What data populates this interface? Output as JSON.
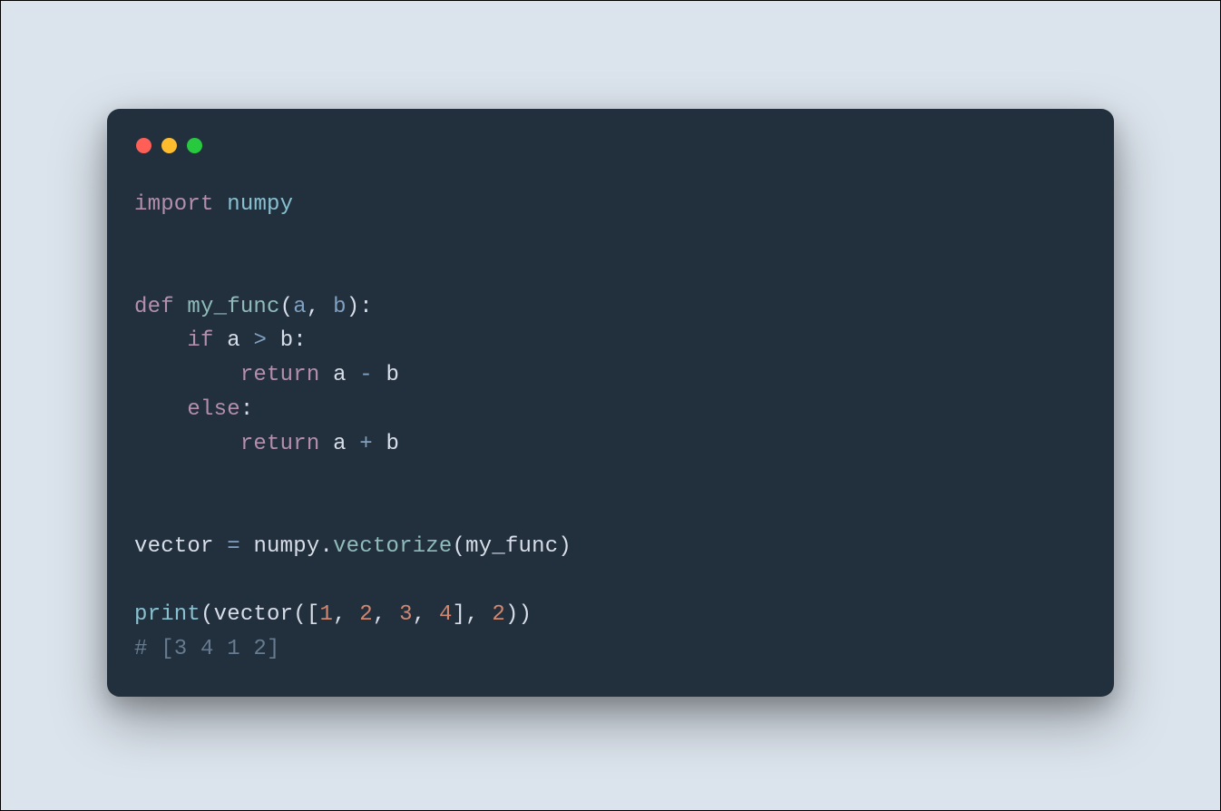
{
  "window": {
    "controls": {
      "close": "close",
      "minimize": "minimize",
      "maximize": "maximize"
    }
  },
  "code": {
    "line1": {
      "import_kw": "import",
      "module": "numpy"
    },
    "line2": "",
    "line3": "",
    "line4": {
      "def_kw": "def",
      "func_name": "my_func",
      "lparen": "(",
      "param_a": "a",
      "comma": ",",
      "space": " ",
      "param_b": "b",
      "rparen": ")",
      "colon": ":"
    },
    "line5": {
      "indent": "    ",
      "if_kw": "if",
      "a": "a",
      "gt": ">",
      "b": "b",
      "colon": ":"
    },
    "line6": {
      "indent": "        ",
      "return_kw": "return",
      "a": "a",
      "minus": "-",
      "b": "b"
    },
    "line7": {
      "indent": "    ",
      "else_kw": "else",
      "colon": ":"
    },
    "line8": {
      "indent": "        ",
      "return_kw": "return",
      "a": "a",
      "plus": "+",
      "b": "b"
    },
    "line9": "",
    "line10": "",
    "line11": {
      "var": "vector",
      "eq": "=",
      "module": "numpy",
      "dot": ".",
      "method": "vectorize",
      "lparen": "(",
      "arg": "my_func",
      "rparen": ")"
    },
    "line12": "",
    "line13": {
      "print_call": "print",
      "lp1": "(",
      "vector": "vector",
      "lp2": "(",
      "lbracket": "[",
      "n1": "1",
      "c1": ",",
      "n2": "2",
      "c2": ",",
      "n3": "3",
      "c3": ",",
      "n4": "4",
      "rbracket": "]",
      "c4": ",",
      "argb": "2",
      "rp2": ")",
      "rp1": ")"
    },
    "line14": {
      "comment": "# [3 4 1 2]"
    }
  }
}
